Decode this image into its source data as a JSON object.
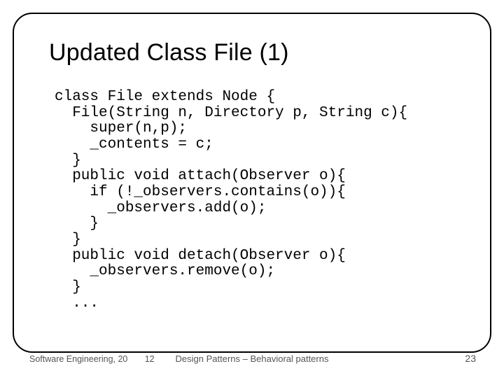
{
  "title": "Updated Class File (1)",
  "code": "class File extends Node {\n  File(String n, Directory p, String c){\n    super(n,p);\n    _contents = c;\n  }\n  public void attach(Observer o){\n    if (!_observers.contains(o)){\n      _observers.add(o);\n    }\n  }\n  public void detach(Observer o){\n    _observers.remove(o);\n  }\n  ...",
  "footer": {
    "left_course": "Software Engineering, 20",
    "left_year": "12",
    "center": "Design Patterns – Behavioral patterns",
    "page": "23"
  }
}
